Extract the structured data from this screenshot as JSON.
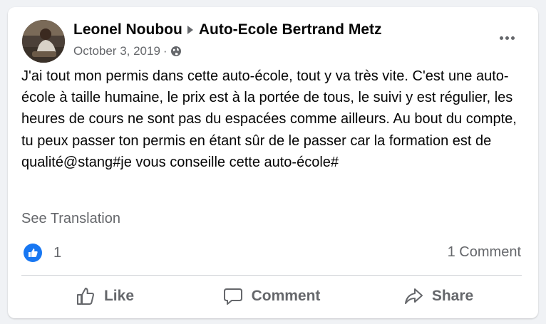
{
  "post": {
    "author": "Leonel Noubou",
    "target_page": "Auto-Ecole Bertrand Metz",
    "date": "October 3, 2019",
    "separator": "·",
    "privacy_icon": "globe-icon",
    "more_icon": "more-options-icon",
    "text": "J'ai tout mon permis dans cette auto-école, tout y va très vite. C'est une auto-école à taille humaine, le prix est à la portée de tous, le suivi y est régulier, les heures de cours ne sont pas du espacées comme ailleurs. Au bout du compte, tu peux passer ton permis en étant sûr de le passer car la formation est de qualité@stang#je vous conseille cette auto-école#",
    "see_translation": "See Translation"
  },
  "stats": {
    "reaction_icon": "like-reaction-icon",
    "reaction_count": "1",
    "comment_count": "1 Comment"
  },
  "actions": {
    "like_label": "Like",
    "comment_label": "Comment",
    "share_label": "Share"
  },
  "colors": {
    "accent": "#1877f2",
    "secondary_text": "#65676b",
    "primary_text": "#050505",
    "background": "#f0f2f5"
  }
}
